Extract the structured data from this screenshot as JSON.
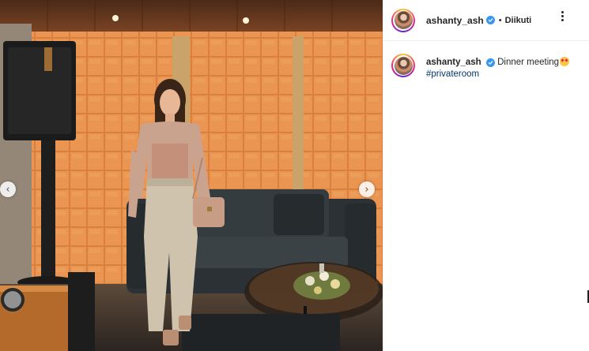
{
  "post": {
    "username": "ashanty_ash",
    "separator": "•",
    "follow_label": "Diikuti",
    "caption": {
      "username": "ashanty_ash",
      "text": "Dinner meeting",
      "emoji": "star-struck-emoji",
      "hashtag": "#privateroom"
    }
  },
  "photo": {
    "alt": "woman posing in lounge with orange tiled wall, black sofa and speaker",
    "prev_glyph": "‹",
    "next_glyph": "›"
  },
  "colors": {
    "tile": "#e08a45",
    "verified": "#3897f0",
    "hashtag": "#00376b"
  }
}
